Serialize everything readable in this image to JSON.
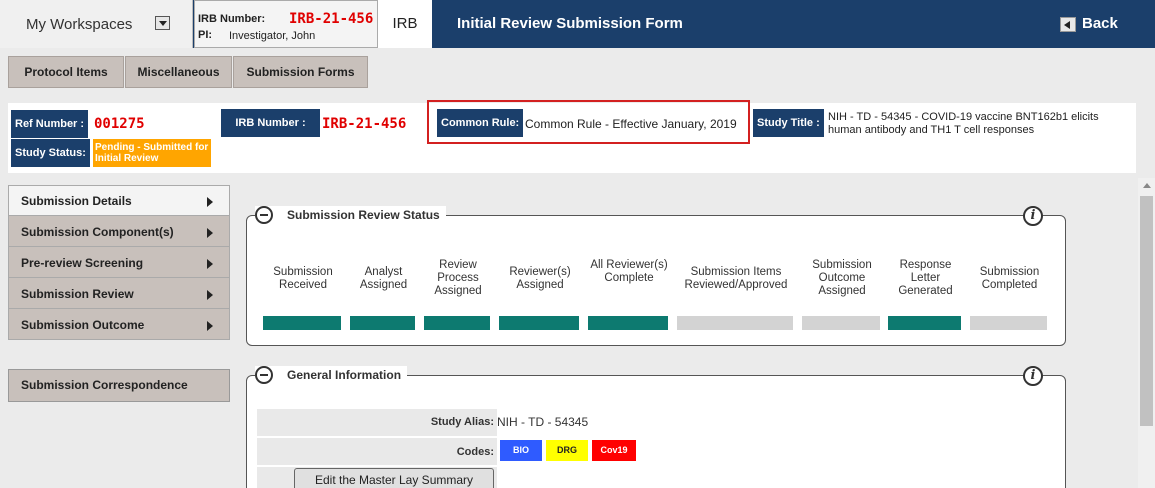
{
  "topbar": {
    "workspaces_label": "My Workspaces",
    "irb_number_label": "IRB Number:",
    "irb_number": "IRB-21-456",
    "pi_label": "PI:",
    "pi_name": "Investigator, John",
    "irb_tab": "IRB",
    "form_title": "Initial Review Submission Form",
    "back_label": "Back"
  },
  "tabs": [
    "Protocol Items",
    "Miscellaneous",
    "Submission Forms"
  ],
  "info": {
    "ref_label": "Ref Number :",
    "ref_value": "001275",
    "irb_label": "IRB Number :",
    "irb_value": "IRB-21-456",
    "common_rule_label": "Common Rule:",
    "common_rule_value": "Common Rule - Effective January, 2019",
    "study_title_label": "Study Title :",
    "study_title_value": "NIH - TD - 54345 - COVID-19 vaccine BNT162b1 elicits human antibody and TH1 T cell responses",
    "status_label": "Study Status:",
    "status_value": "Pending - Submitted for Initial Review",
    "status_color": "#ffa500"
  },
  "nav": {
    "items": [
      "Submission Details",
      "Submission Component(s)",
      "Pre-review Screening",
      "Submission Review",
      "Submission Outcome"
    ],
    "correspondence": "Submission Correspondence"
  },
  "review_status": {
    "title": "Submission Review Status",
    "steps": [
      {
        "label": "Submission Received",
        "complete": true
      },
      {
        "label": "Analyst Assigned",
        "complete": true
      },
      {
        "label": "Review Process Assigned",
        "complete": true
      },
      {
        "label": "Reviewer(s) Assigned",
        "complete": true
      },
      {
        "label": "All Reviewer(s) Complete",
        "complete": true
      },
      {
        "label": "Submission Items Reviewed/Approved",
        "complete": false
      },
      {
        "label": "Submission Outcome Assigned",
        "complete": false
      },
      {
        "label": "Response Letter Generated",
        "complete": true
      },
      {
        "label": "Submission Completed",
        "complete": false
      }
    ],
    "complete_color": "#0d7a70",
    "incomplete_color": "#d3d3d3"
  },
  "general_info": {
    "title": "General Information",
    "alias_label": "Study Alias:",
    "alias_value": "NIH - TD - 54345",
    "codes_label": "Codes:",
    "codes": [
      {
        "label": "BIO",
        "bg": "#2f5bff",
        "fg": "#ffffff"
      },
      {
        "label": "DRG",
        "bg": "#ffff00",
        "fg": "#222222"
      },
      {
        "label": "Cov19",
        "bg": "#ff0000",
        "fg": "#ffffff"
      }
    ],
    "edit_button": "Edit the Master Lay Summary"
  }
}
